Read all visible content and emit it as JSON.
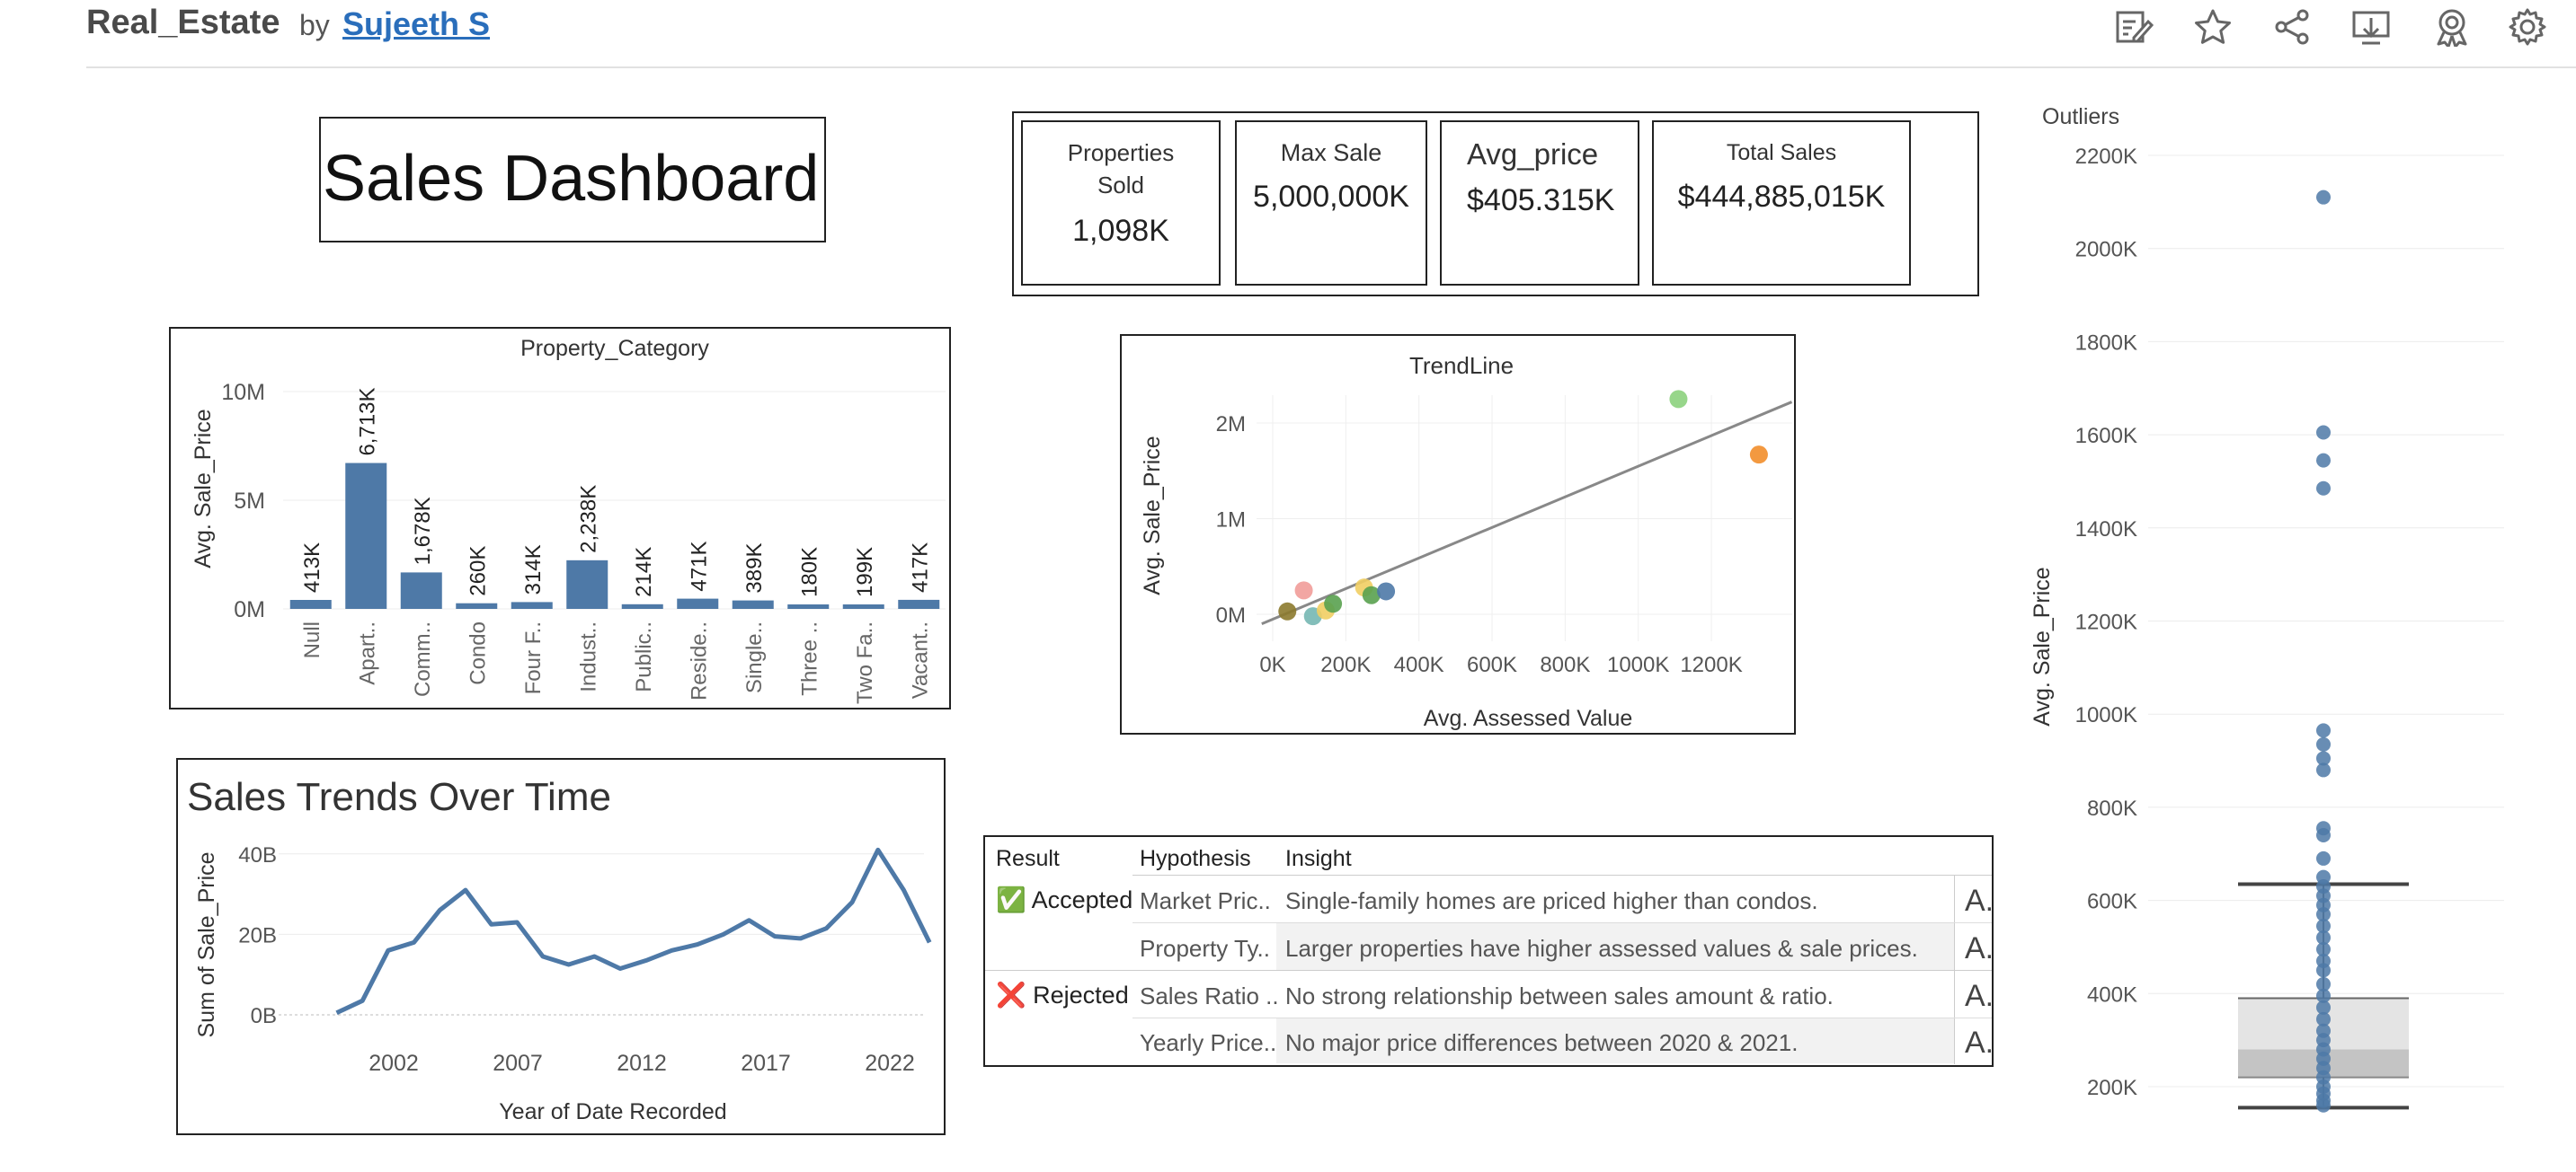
{
  "header": {
    "workbook_title": "Real_Estate",
    "by_label": "by",
    "author": "Sujeeth S"
  },
  "toolbar": {
    "icons": [
      "edit-icon",
      "favorite-star-icon",
      "share-icon",
      "download-icon",
      "metrics-icon",
      "settings-gear-icon"
    ]
  },
  "dashboard": {
    "title": "Sales Dashboard"
  },
  "kpis": [
    {
      "label_line1": "Properties",
      "label_line2": "Sold",
      "value": "1,098K"
    },
    {
      "label_line1": "Max Sale",
      "label_line2": "",
      "value": "5,000,000K"
    },
    {
      "label_line1": "Avg_price",
      "label_line2": "",
      "value": "$405.315K"
    },
    {
      "label_line1": "Total Sales",
      "label_line2": "",
      "value": "$444,885,015K"
    }
  ],
  "property_category": {
    "chart_data": {
      "type": "bar",
      "title": "Property_Category",
      "ylabel": "Avg. Sale_Price",
      "xlabel": "",
      "categories": [
        "Null",
        "Apart..",
        "Comm..",
        "Condo",
        "Four F..",
        "Indust..",
        "Public..",
        "Reside..",
        "Single..",
        "Three ..",
        "Two Fa..",
        "Vacant.."
      ],
      "values": [
        413,
        6713,
        1678,
        260,
        314,
        2238,
        214,
        471,
        389,
        180,
        199,
        417
      ],
      "data_labels": [
        "413K",
        "6,713K",
        "1,678K",
        "260K",
        "314K",
        "2,238K",
        "214K",
        "471K",
        "389K",
        "180K",
        "199K",
        "417K"
      ],
      "value_unit": "K",
      "yticks": [
        "10M",
        "5M",
        "0M"
      ],
      "ytick_values": [
        10000,
        5000,
        0
      ],
      "color": "#4e79a7"
    }
  },
  "trendline": {
    "chart_data": {
      "type": "scatter",
      "title": "TrendLine",
      "xlabel": "Avg. Assessed Value",
      "ylabel": "Avg. Sale_Price",
      "xticks": [
        "0K",
        "200K",
        "400K",
        "600K",
        "800K",
        "1000K",
        "1200K"
      ],
      "xtick_values": [
        0,
        200,
        400,
        600,
        800,
        1000,
        1200
      ],
      "yticks": [
        "2M",
        "1M",
        "0M"
      ],
      "ytick_values": [
        2000,
        1000,
        0
      ],
      "points": [
        {
          "x": 40,
          "y": 30,
          "color": "#8c7a2e"
        },
        {
          "x": 85,
          "y": 250,
          "color": "#f19c99"
        },
        {
          "x": 110,
          "y": -20,
          "color": "#76b7b2"
        },
        {
          "x": 145,
          "y": 40,
          "color": "#f1ce63"
        },
        {
          "x": 165,
          "y": 110,
          "color": "#59a14f"
        },
        {
          "x": 250,
          "y": 280,
          "color": "#f1ce63"
        },
        {
          "x": 270,
          "y": 200,
          "color": "#59a14f"
        },
        {
          "x": 310,
          "y": 240,
          "color": "#4e79a7"
        },
        {
          "x": 1110,
          "y": 2250,
          "color": "#8cd17d"
        },
        {
          "x": 1330,
          "y": 1670,
          "color": "#f28e2b"
        }
      ],
      "trend": {
        "x1": -30,
        "y1": -100,
        "x2": 1420,
        "y2": 2220,
        "color": "#888888"
      }
    }
  },
  "sales_trend": {
    "chart_data": {
      "type": "line",
      "title": "Sales Trends Over Time",
      "xlabel": "Year of Date Recorded",
      "ylabel": "Sum of Sale_Price",
      "xticks": [
        "2002",
        "2007",
        "2012",
        "2017",
        "2022"
      ],
      "xtick_values": [
        2002,
        2007,
        2012,
        2017,
        2022
      ],
      "yticks": [
        "40B",
        "20B",
        "0B"
      ],
      "ytick_values": [
        40,
        20,
        0
      ],
      "x": [
        1999,
        2001,
        2002,
        2003,
        2004,
        2005,
        2006,
        2007,
        2008,
        2009,
        2010,
        2011,
        2012,
        2013,
        2014,
        2015,
        2016,
        2017,
        2018,
        2019,
        2020,
        2021,
        2022
      ],
      "values": [
        0.5,
        3.5,
        16,
        18,
        26,
        31,
        22.5,
        23,
        14.5,
        12.5,
        14.5,
        11.5,
        13.5,
        16,
        17.5,
        20,
        23.5,
        19.5,
        19,
        21.5,
        28,
        41,
        31,
        18
      ],
      "color": "#4e79a7"
    }
  },
  "hypothesis_table": {
    "headers": {
      "result": "Result",
      "hypothesis": "Hypothesis",
      "insight": "Insight"
    },
    "rows": [
      {
        "result_icon": "check-mark-icon",
        "result": "Accepted",
        "hypothesis": "Market Pric..",
        "insight": "Single-family homes are priced higher than condos.",
        "abc": "A."
      },
      {
        "result_icon": "",
        "result": "",
        "hypothesis": "Property Ty..",
        "insight": "Larger properties have higher assessed values & sale prices.",
        "abc": "A."
      },
      {
        "result_icon": "cross-mark-icon",
        "result": "Rejected",
        "hypothesis": "Sales Ratio ..",
        "insight": "No strong relationship between sales amount & ratio.",
        "abc": "A."
      },
      {
        "result_icon": "",
        "result": "",
        "hypothesis": "Yearly Price..",
        "insight": "No major price differences between 2020 & 2021.",
        "abc": "A."
      }
    ],
    "accepted_glyph": "✅",
    "rejected_glyph": "❌"
  },
  "outliers": {
    "chart_data": {
      "type": "scatter",
      "title": "Outliers",
      "ylabel": "Avg. Sale_Price",
      "yticks": [
        "2200K",
        "2000K",
        "1800K",
        "1600K",
        "1400K",
        "1200K",
        "1000K",
        "800K",
        "600K",
        "400K",
        "200K"
      ],
      "ytick_values": [
        2200,
        2000,
        1800,
        1600,
        1400,
        1200,
        1000,
        800,
        600,
        400,
        200
      ],
      "points_y": [
        2110,
        1605,
        1545,
        1485,
        965,
        935,
        905,
        880,
        755,
        740,
        690,
        650,
        630,
        610,
        590,
        570,
        545,
        520,
        495,
        470,
        450,
        420,
        395,
        370,
        345,
        320,
        300,
        280,
        260,
        240,
        220,
        200,
        185,
        170,
        160
      ],
      "box": {
        "whisker_high": 635,
        "q3": 390,
        "median": 280,
        "q1": 220,
        "whisker_low": 155
      },
      "point_color": "#4e79a7"
    }
  }
}
